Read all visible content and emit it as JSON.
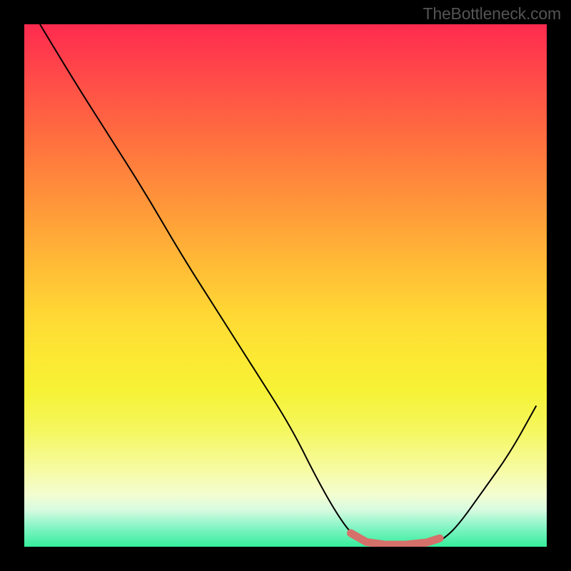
{
  "attribution": "TheBottleneck.com",
  "chart_data": {
    "type": "line",
    "title": "",
    "xlabel": "",
    "ylabel": "",
    "xlim": [
      0,
      100
    ],
    "ylim": [
      0,
      100
    ],
    "background_gradient": {
      "top": "#ff2a4f",
      "mid_top": "#ffd934",
      "mid_bottom": "#f5f760",
      "bottom": "#35ed9c",
      "description": "vertical red→orange→yellow→green gradient, green band at bottom"
    },
    "series": [
      {
        "name": "curve",
        "stroke": "#000000",
        "stroke_width": 2,
        "points_xy": [
          [
            3,
            100
          ],
          [
            9,
            90
          ],
          [
            16,
            79
          ],
          [
            23,
            68
          ],
          [
            30,
            56
          ],
          [
            37,
            45
          ],
          [
            44,
            34
          ],
          [
            51,
            23
          ],
          [
            56,
            13
          ],
          [
            60,
            6
          ],
          [
            63,
            2
          ],
          [
            66,
            0.5
          ],
          [
            70,
            0.2
          ],
          [
            74,
            0.2
          ],
          [
            78,
            0.5
          ],
          [
            80,
            1.3
          ],
          [
            83,
            4
          ],
          [
            88,
            11
          ],
          [
            93,
            18
          ],
          [
            98,
            27
          ]
        ]
      },
      {
        "name": "trough-highlight",
        "stroke": "#d6706a",
        "stroke_width": 11,
        "linecap": "round",
        "points_xy": [
          [
            62.5,
            2.6
          ],
          [
            65.5,
            0.9
          ],
          [
            69,
            0.4
          ],
          [
            73,
            0.4
          ],
          [
            77,
            0.8
          ],
          [
            79.5,
            1.6
          ]
        ]
      }
    ]
  }
}
